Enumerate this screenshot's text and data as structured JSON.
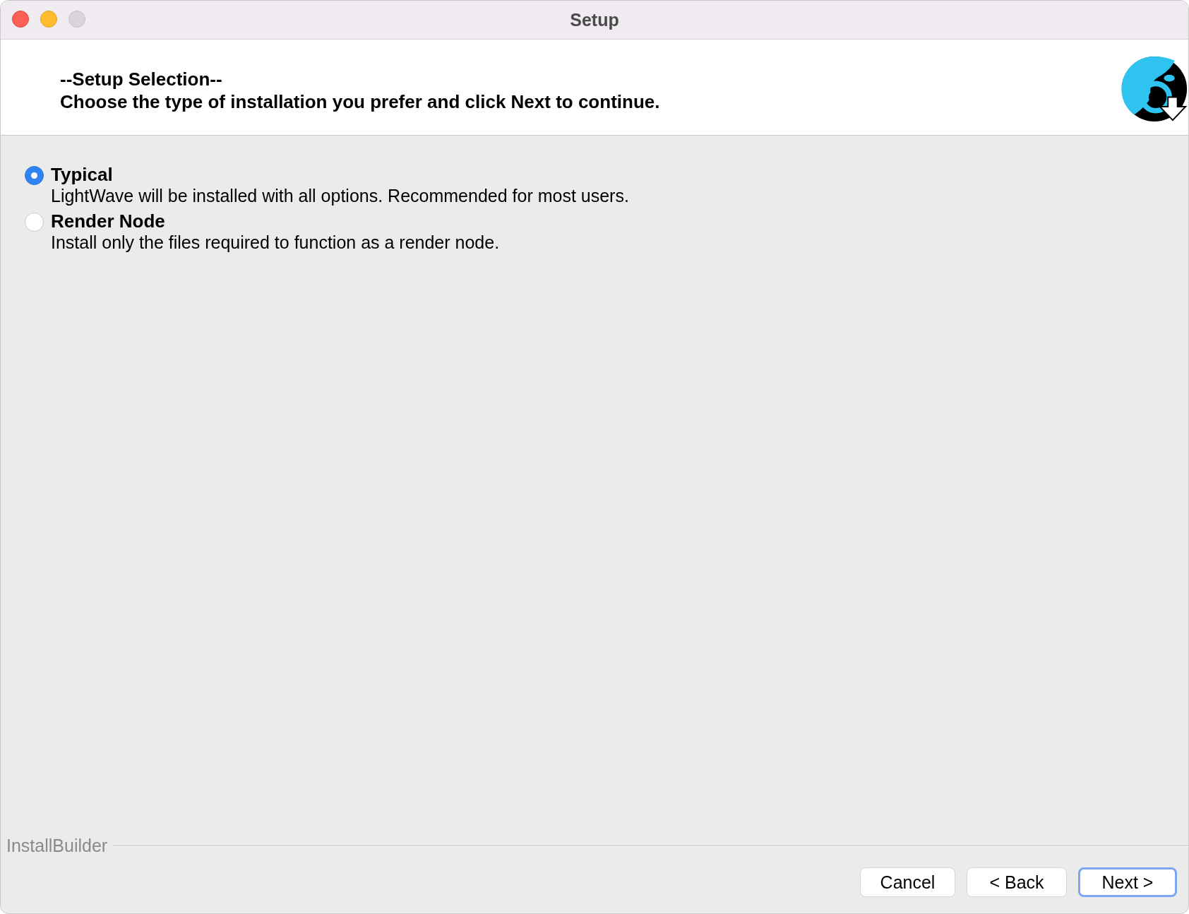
{
  "window": {
    "title": "Setup"
  },
  "header": {
    "title": "--Setup Selection--",
    "subtitle": "Choose the type of installation you prefer and click Next to continue."
  },
  "options": [
    {
      "label": "Typical",
      "description": "LightWave will be installed with all options. Recommended for most users.",
      "selected": true
    },
    {
      "label": "Render Node",
      "description": "Install only the files required to function as a render node.",
      "selected": false
    }
  ],
  "footer": {
    "brand": "InstallBuilder"
  },
  "buttons": [
    {
      "label": "Cancel",
      "focused": false
    },
    {
      "label": "< Back",
      "focused": false
    },
    {
      "label": "Next >",
      "focused": true
    }
  ]
}
